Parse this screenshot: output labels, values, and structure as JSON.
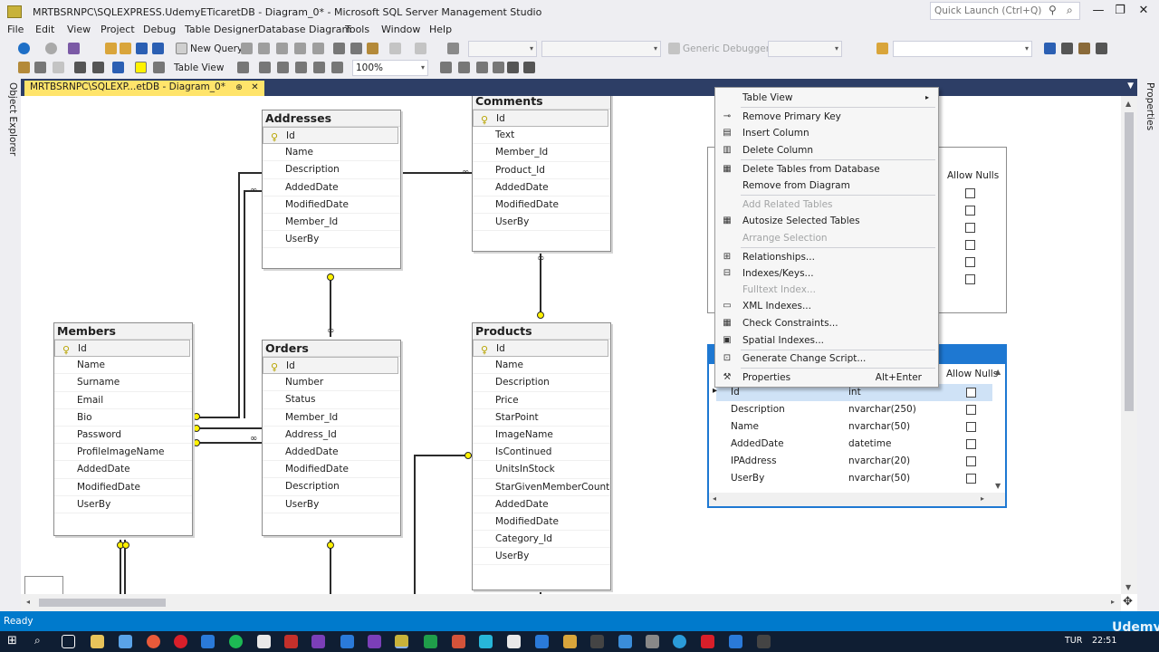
{
  "window": {
    "title": "MRTBSRNPC\\SQLEXPRESS.UdemyETicaretDB - Diagram_0* - Microsoft SQL Server Management Studio",
    "quick_launch_placeholder": "Quick Launch (Ctrl+Q)",
    "minimize": "—",
    "maximize": "❐",
    "close": "✕"
  },
  "menu": [
    "File",
    "Edit",
    "View",
    "Project",
    "Debug",
    "Table Designer",
    "Database Diagram",
    "Tools",
    "Window",
    "Help"
  ],
  "toolbar": {
    "new_query": "New Query",
    "debugger": "Generic Debugger",
    "table_view": "Table View",
    "zoom": "100%"
  },
  "side_tabs": {
    "left": "Object Explorer",
    "right": "Properties"
  },
  "document_tab": {
    "title": "MRTBSRNPC\\SQLEXP...etDB - Diagram_0*",
    "pin": "⊕",
    "close": "✕"
  },
  "tables": {
    "addresses": {
      "title": "Addresses",
      "columns": [
        "Id",
        "Name",
        "Description",
        "AddedDate",
        "ModifiedDate",
        "Member_Id",
        "UserBy"
      ]
    },
    "comments": {
      "title": "Comments",
      "columns": [
        "Id",
        "Text",
        "Member_Id",
        "Product_Id",
        "AddedDate",
        "ModifiedDate",
        "UserBy"
      ]
    },
    "members": {
      "title": "Members",
      "columns": [
        "Id",
        "Name",
        "Surname",
        "Email",
        "Bio",
        "Password",
        "ProfileImageName",
        "AddedDate",
        "ModifiedDate",
        "UserBy"
      ]
    },
    "orders": {
      "title": "Orders",
      "columns": [
        "Id",
        "Number",
        "Status",
        "Member_Id",
        "Address_Id",
        "AddedDate",
        "ModifiedDate",
        "Description",
        "UserBy"
      ]
    },
    "products": {
      "title": "Products",
      "columns": [
        "Id",
        "Name",
        "Description",
        "Price",
        "StarPoint",
        "ImageName",
        "IsContinued",
        "UnitsInStock",
        "StarGivenMemberCount",
        "AddedDate",
        "ModifiedDate",
        "Category_Id",
        "UserBy"
      ]
    }
  },
  "grid_table_top": {
    "allow_nulls_header": "Allow Nulls"
  },
  "grid_table": {
    "allow_nulls_header": "Allow Nulls",
    "rows": [
      {
        "name": "Id",
        "type": "int"
      },
      {
        "name": "Description",
        "type": "nvarchar(250)"
      },
      {
        "name": "Name",
        "type": "nvarchar(50)"
      },
      {
        "name": "AddedDate",
        "type": "datetime"
      },
      {
        "name": "IPAddress",
        "type": "nvarchar(20)"
      },
      {
        "name": "UserBy",
        "type": "nvarchar(50)"
      }
    ]
  },
  "context_menu": {
    "table_view": "Table View",
    "remove_primary_key": "Remove Primary Key",
    "insert_column": "Insert Column",
    "delete_column": "Delete Column",
    "delete_tables_from_database": "Delete Tables from Database",
    "remove_from_diagram": "Remove from Diagram",
    "add_related_tables": "Add Related Tables",
    "autosize_selected_tables": "Autosize Selected Tables",
    "arrange_selection": "Arrange Selection",
    "relationships": "Relationships...",
    "indexes_keys": "Indexes/Keys...",
    "fulltext_index": "Fulltext Index...",
    "xml_indexes": "XML Indexes...",
    "check_constraints": "Check Constraints...",
    "spatial_indexes": "Spatial Indexes...",
    "generate_change_script": "Generate Change Script...",
    "properties": "Properties",
    "properties_shortcut": "Alt+Enter"
  },
  "status": {
    "text": "Ready"
  },
  "taskbar": {
    "lang": "TUR",
    "time": "22:51"
  },
  "watermark": "Udemy",
  "colors": {
    "accent": "#007acc",
    "doc_header": "#2d3e66",
    "tab_active": "#ffe46b",
    "selection": "#1e78d2",
    "key_yellow": "#fff200"
  }
}
